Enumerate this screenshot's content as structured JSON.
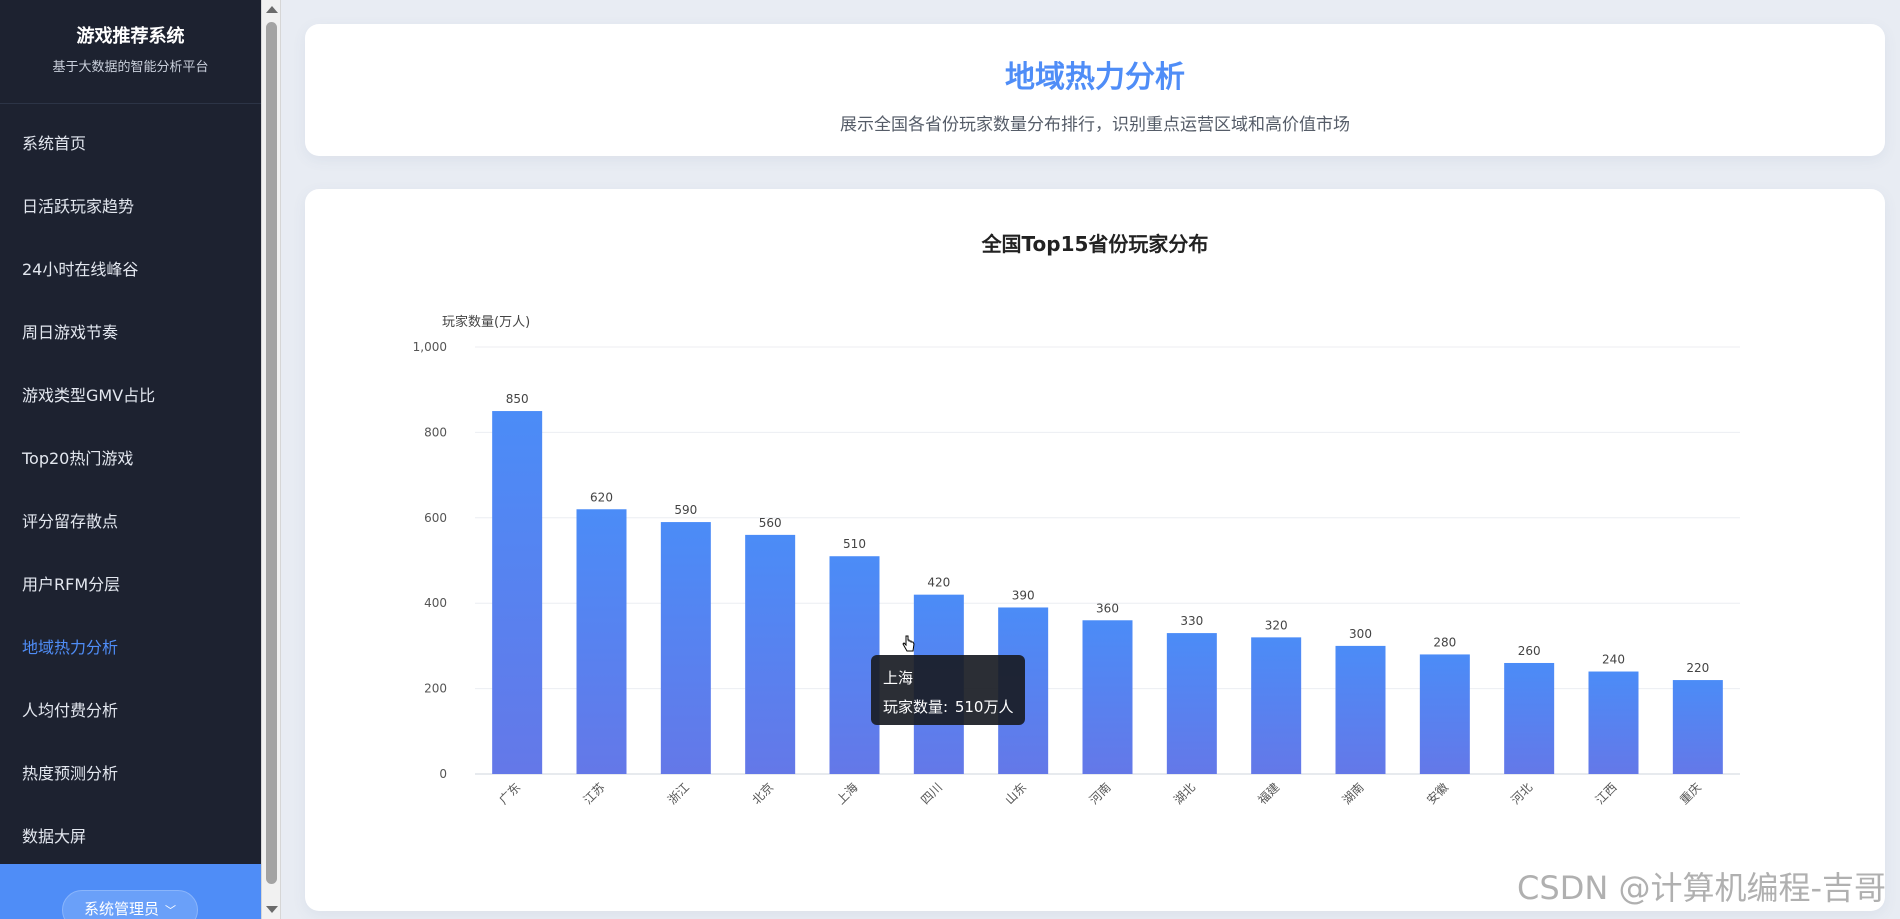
{
  "sidebar": {
    "brand_title": "游戏推荐系统",
    "brand_subtitle": "基于大数据的智能分析平台",
    "items": [
      {
        "label": "系统首页",
        "active": false
      },
      {
        "label": "日活跃玩家趋势",
        "active": false
      },
      {
        "label": "24小时在线峰谷",
        "active": false
      },
      {
        "label": "周日游戏节奏",
        "active": false
      },
      {
        "label": "游戏类型GMV占比",
        "active": false
      },
      {
        "label": "Top20热门游戏",
        "active": false
      },
      {
        "label": "评分留存散点",
        "active": false
      },
      {
        "label": "用户RFM分层",
        "active": false
      },
      {
        "label": "地域热力分析",
        "active": true
      },
      {
        "label": "人均付费分析",
        "active": false
      },
      {
        "label": "热度预测分析",
        "active": false
      },
      {
        "label": "数据大屏",
        "active": false
      }
    ],
    "user_label": "系统管理员",
    "user_chevron": "﹀"
  },
  "header": {
    "title": "地域热力分析",
    "subtitle": "展示全国各省份玩家数量分布排行，识别重点运营区域和高价值市场"
  },
  "chart_data": {
    "type": "bar",
    "title": "全国Top15省份玩家分布",
    "ylabel": "玩家数量(万人)",
    "xlabel": "",
    "ylim": [
      0,
      1000
    ],
    "yticks": [
      0,
      200,
      400,
      600,
      800,
      1000
    ],
    "ytick_labels": [
      "0",
      "200",
      "400",
      "600",
      "800",
      "1,000"
    ],
    "categories": [
      "广东",
      "江苏",
      "浙江",
      "北京",
      "上海",
      "四川",
      "山东",
      "河南",
      "湖北",
      "福建",
      "湖南",
      "安徽",
      "河北",
      "江西",
      "重庆"
    ],
    "values": [
      850,
      620,
      590,
      560,
      510,
      420,
      390,
      360,
      330,
      320,
      300,
      280,
      260,
      240,
      220
    ],
    "grid": true,
    "bar_color_top": "#4b8cf7",
    "bar_color_bottom": "#6478e8"
  },
  "tooltip": {
    "name": "上海",
    "label": "玩家数量:",
    "value": "510万人"
  },
  "watermark": "CSDN @计算机编程-吉哥",
  "colors": {
    "accent": "#4f8df7",
    "sidebar_bg": "#1d2230"
  }
}
